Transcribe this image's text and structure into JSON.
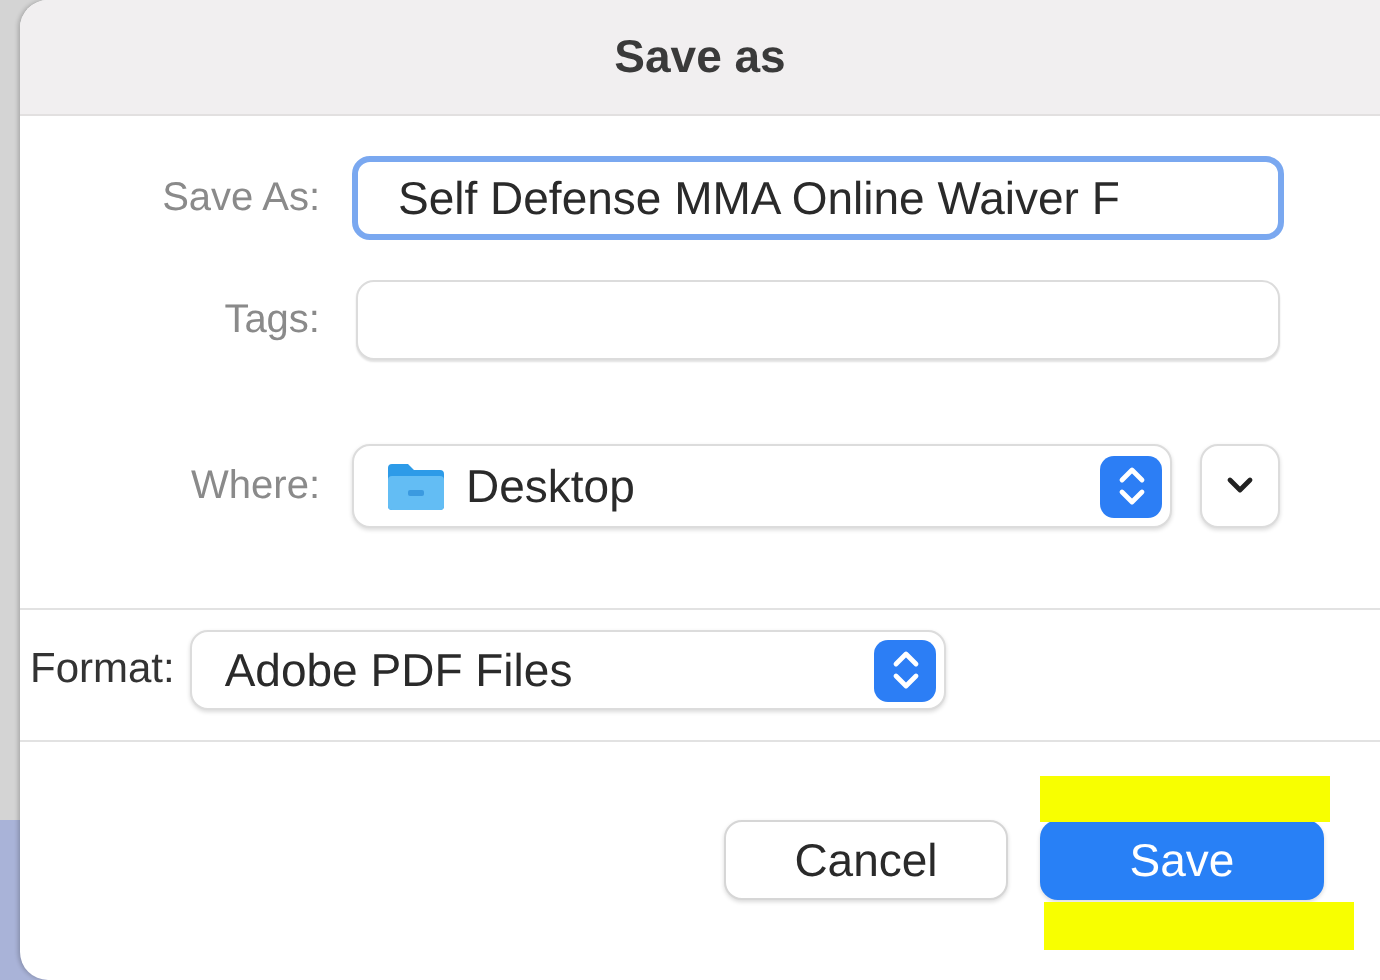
{
  "dialog": {
    "title": "Save as"
  },
  "fields": [
    {
      "label": "Save As:",
      "value": "Self Defense MMA Online Waiver F",
      "focused": true
    },
    {
      "label": "Tags:",
      "focused": false
    }
  ],
  "where": {
    "label": "Where:",
    "value": "Desktop"
  },
  "format": {
    "label": "Format:",
    "value": "Adobe PDF Files"
  },
  "buttons": [
    {
      "label": "Cancel",
      "default": false
    },
    {
      "label": "Save",
      "default": true
    }
  ]
}
